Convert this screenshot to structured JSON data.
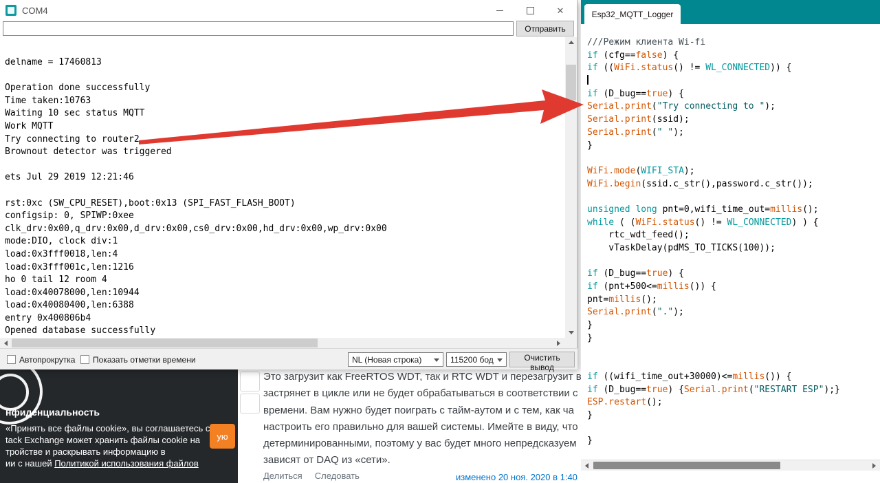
{
  "colors": {
    "accent_teal": "#00878F",
    "arrow_red": "#E03A30",
    "accept_orange": "#F48024",
    "link_blue": "#0074CC"
  },
  "serial_monitor": {
    "title": "COM4",
    "input_value": "",
    "send_label": "Отправить",
    "output_lines": [
      "delname = 17460813",
      "",
      "Operation done successfully",
      "Time taken:10763",
      "Waiting 10 sec status MQTT",
      "Work MQTT",
      "Try connecting to router2",
      "Brownout detector was triggered",
      "",
      "ets Jul 29 2019 12:21:46",
      "",
      "rst:0xc (SW_CPU_RESET),boot:0x13 (SPI_FAST_FLASH_BOOT)",
      "configsip: 0, SPIWP:0xee",
      "clk_drv:0x00,q_drv:0x00,d_drv:0x00,cs0_drv:0x00,hd_drv:0x00,wp_drv:0x00",
      "mode:DIO, clock div:1",
      "load:0x3fff0018,len:4",
      "load:0x3fff001c,len:1216",
      "ho 0 tail 12 room 4",
      "load:0x40078000,len:10944",
      "load:0x40080400,len:6388",
      "entry 0x400806b4",
      "Opened database successfully"
    ],
    "autoscroll_label": "Автопрокрутка",
    "timestamps_label": "Показать отметки времени",
    "line_ending_value": "NL (Новая строка)",
    "baud_value": "115200 бод",
    "clear_label": "Очистить вывод"
  },
  "editor": {
    "tab_label": "Esp32_MQTT_Logger",
    "colors": {
      "kw": "#00979C",
      "fn": "#D35400",
      "lit": "#D35400",
      "str": "#005C5F",
      "com": "#434F54",
      "pl": "#000000"
    },
    "lines": [
      [
        [
          "///Режим клиента Wi-fi",
          "com"
        ]
      ],
      [
        [
          "if",
          "kw"
        ],
        [
          " (cfg==",
          "pl"
        ],
        [
          "false",
          "lit"
        ],
        [
          ") {",
          "pl"
        ]
      ],
      [
        [
          "if",
          "kw"
        ],
        [
          " ((",
          "pl"
        ],
        [
          "WiFi.status",
          "fn"
        ],
        [
          "() != ",
          "pl"
        ],
        [
          "WL_CONNECTED",
          "kw"
        ],
        [
          ")) {",
          "pl"
        ]
      ],
      [
        [
          "",
          "cursor"
        ]
      ],
      [
        [
          "if",
          "kw"
        ],
        [
          " (D_bug==",
          "pl"
        ],
        [
          "true",
          "lit"
        ],
        [
          ") {",
          "pl"
        ]
      ],
      [
        [
          "Serial.print",
          "fn"
        ],
        [
          "(",
          "pl"
        ],
        [
          "\"Try connecting to \"",
          "str"
        ],
        [
          ");",
          "pl"
        ]
      ],
      [
        [
          "Serial.print",
          "fn"
        ],
        [
          "(ssid);",
          "pl"
        ]
      ],
      [
        [
          "Serial.print",
          "fn"
        ],
        [
          "(",
          "pl"
        ],
        [
          "\" \"",
          "str"
        ],
        [
          ");",
          "pl"
        ]
      ],
      [
        [
          "}",
          "pl"
        ]
      ],
      [],
      [
        [
          "WiFi.mode",
          "fn"
        ],
        [
          "(",
          "pl"
        ],
        [
          "WIFI_STA",
          "kw"
        ],
        [
          ");",
          "pl"
        ]
      ],
      [
        [
          "WiFi.begin",
          "fn"
        ],
        [
          "(ssid.c_str(),password.c_str());",
          "pl"
        ]
      ],
      [],
      [
        [
          "unsigned",
          "kw"
        ],
        [
          " ",
          "pl"
        ],
        [
          "long",
          "kw"
        ],
        [
          " pnt=0,wifi_time_out=",
          "pl"
        ],
        [
          "millis",
          "fn"
        ],
        [
          "();",
          "pl"
        ]
      ],
      [
        [
          "while",
          "kw"
        ],
        [
          " ( (",
          "pl"
        ],
        [
          "WiFi.status",
          "fn"
        ],
        [
          "() != ",
          "pl"
        ],
        [
          "WL_CONNECTED",
          "kw"
        ],
        [
          ") ) {",
          "pl"
        ]
      ],
      [
        [
          "    rtc_wdt_feed();",
          "pl"
        ]
      ],
      [
        [
          "    vTaskDelay(pdMS_TO_TICKS(100));",
          "pl"
        ]
      ],
      [],
      [
        [
          "if",
          "kw"
        ],
        [
          " (D_bug==",
          "pl"
        ],
        [
          "true",
          "lit"
        ],
        [
          ") {",
          "pl"
        ]
      ],
      [
        [
          "if",
          "kw"
        ],
        [
          " (pnt+500<=",
          "pl"
        ],
        [
          "millis",
          "fn"
        ],
        [
          "()) {",
          "pl"
        ]
      ],
      [
        [
          "pnt=",
          "pl"
        ],
        [
          "millis",
          "fn"
        ],
        [
          "();",
          "pl"
        ]
      ],
      [
        [
          "Serial.print",
          "fn"
        ],
        [
          "(",
          "pl"
        ],
        [
          "\".\"",
          "str"
        ],
        [
          ");",
          "pl"
        ]
      ],
      [
        [
          "}",
          "pl"
        ]
      ],
      [
        [
          "}",
          "pl"
        ]
      ],
      [],
      [],
      [
        [
          "if",
          "kw"
        ],
        [
          " ((wifi_time_out+30000)<=",
          "pl"
        ],
        [
          "millis",
          "fn"
        ],
        [
          "()) {",
          "pl"
        ]
      ],
      [
        [
          "if",
          "kw"
        ],
        [
          " (D_bug==",
          "pl"
        ],
        [
          "true",
          "lit"
        ],
        [
          ") {",
          "pl"
        ],
        [
          "Serial.print",
          "fn"
        ],
        [
          "(",
          "pl"
        ],
        [
          "\"RESTART ESP\"",
          "str"
        ],
        [
          ");}",
          "pl"
        ]
      ],
      [
        [
          "ESP.restart",
          "fn"
        ],
        [
          "();",
          "pl"
        ]
      ],
      [
        [
          "}",
          "pl"
        ]
      ],
      [],
      [
        [
          "}",
          "pl"
        ]
      ]
    ]
  },
  "webpage": {
    "paragraph_lines": [
      "Это загрузит как FreeRTOS WDT, так и RTC WDT и перезагрузит ва",
      "застрянет в цикле или не будет обрабатываться в соответствии с",
      "времени. Вам нужно будет поиграть с тайм-аутом и с тем, как ча",
      "настроить его правильно для вашей системы. Имейте в виду, что",
      "детерминированными, поэтому у вас будет много непредсказуем",
      "зависят от DAQ из «сети»."
    ],
    "share_label": "Делиться",
    "follow_label": "Следовать",
    "edited_label": "изменено 20 ноя. 2020 в 1:40"
  },
  "cookie": {
    "title": "нфиденциальность",
    "lines": [
      "«Принять все файлы cookie», вы соглашаетесь с",
      "tack Exchange может хранить файлы cookie на",
      "тройстве и раскрывать информацию в"
    ],
    "last_line_pre": "ии с нашей ",
    "last_line_link": "Политикой использования файлов",
    "accept_fragment": "ую"
  }
}
